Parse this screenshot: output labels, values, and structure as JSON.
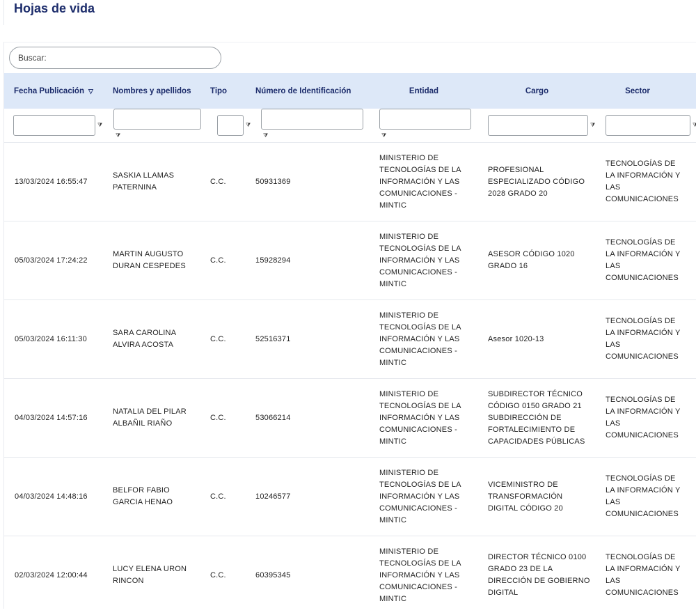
{
  "page": {
    "title": "Hojas de vida"
  },
  "search": {
    "placeholder": "Buscar:"
  },
  "table": {
    "columns": [
      {
        "label": "Fecha Publicación",
        "sort_icon": "▽"
      },
      {
        "label": "Nombres y apellidos"
      },
      {
        "label": "Tipo"
      },
      {
        "label": "Número de Identificación"
      },
      {
        "label": "Entidad"
      },
      {
        "label": "Cargo"
      },
      {
        "label": "Sector"
      }
    ],
    "filter_icon": "⧩",
    "rows": [
      {
        "fecha": "13/03/2024 16:55:47",
        "nombre": "SASKIA LLAMAS PATERNINA",
        "tipo": "C.C.",
        "numero": "50931369",
        "entidad": "MINISTERIO DE TECNOLOGÍAS DE LA INFORMACIÓN Y LAS COMUNICACIONES - MINTIC",
        "cargo": "PROFESIONAL ESPECIALIZADO CÓDIGO 2028 GRADO 20",
        "sector": "TECNOLOGÍAS DE LA INFORMACIÓN Y LAS COMUNICACIONES"
      },
      {
        "fecha": "05/03/2024 17:24:22",
        "nombre": "MARTIN AUGUSTO DURAN CESPEDES",
        "tipo": "C.C.",
        "numero": "15928294",
        "entidad": "MINISTERIO DE TECNOLOGÍAS DE LA INFORMACIÓN Y LAS COMUNICACIONES - MINTIC",
        "cargo": "ASESOR CÓDIGO 1020 GRADO 16",
        "sector": "TECNOLOGÍAS DE LA INFORMACIÓN Y LAS COMUNICACIONES"
      },
      {
        "fecha": "05/03/2024 16:11:30",
        "nombre": "SARA CAROLINA ALVIRA ACOSTA",
        "tipo": "C.C.",
        "numero": "52516371",
        "entidad": "MINISTERIO DE TECNOLOGÍAS DE LA INFORMACIÓN Y LAS COMUNICACIONES - MINTIC",
        "cargo": "Asesor 1020-13",
        "sector": "TECNOLOGÍAS DE LA INFORMACIÓN Y LAS COMUNICACIONES"
      },
      {
        "fecha": "04/03/2024 14:57:16",
        "nombre": "NATALIA DEL PILAR ALBAÑIL RIAÑO",
        "tipo": "C.C.",
        "numero": "53066214",
        "entidad": "MINISTERIO DE TECNOLOGÍAS DE LA INFORMACIÓN Y LAS COMUNICACIONES - MINTIC",
        "cargo": "SUBDIRECTOR TÉCNICO CÓDIGO 0150 GRADO 21 SUBDIRECCIÓN DE FORTALECIMIENTO DE CAPACIDADES PÚBLICAS",
        "sector": "TECNOLOGÍAS DE LA INFORMACIÓN Y LAS COMUNICACIONES"
      },
      {
        "fecha": "04/03/2024 14:48:16",
        "nombre": "BELFOR FABIO GARCIA HENAO",
        "tipo": "C.C.",
        "numero": "10246577",
        "entidad": "MINISTERIO DE TECNOLOGÍAS DE LA INFORMACIÓN Y LAS COMUNICACIONES - MINTIC",
        "cargo": "VICEMINISTRO DE TRANSFORMACIÓN DIGITAL CÓDIGO 20",
        "sector": "TECNOLOGÍAS DE LA INFORMACIÓN Y LAS COMUNICACIONES"
      },
      {
        "fecha": "02/03/2024 12:00:44",
        "nombre": "LUCY ELENA URON RINCON",
        "tipo": "C.C.",
        "numero": "60395345",
        "entidad": "MINISTERIO DE TECNOLOGÍAS DE LA INFORMACIÓN Y LAS COMUNICACIONES - MINTIC",
        "cargo": "DIRECTOR TÉCNICO 0100 GRADO 23 DE LA DIRECCIÓN DE GOBIERNO DIGITAL",
        "sector": "TECNOLOGÍAS DE LA INFORMACIÓN Y LAS COMUNICACIONES"
      }
    ]
  }
}
